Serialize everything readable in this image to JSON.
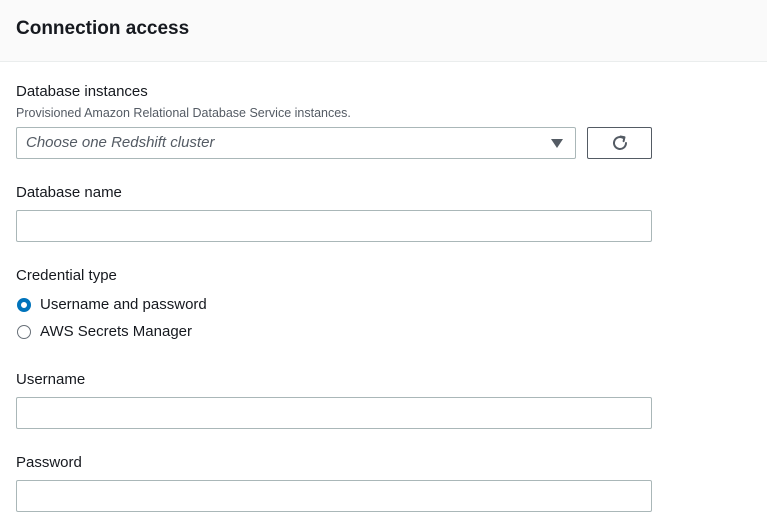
{
  "header": {
    "title": "Connection access"
  },
  "database_instances": {
    "label": "Database instances",
    "description": "Provisioned Amazon Relational Database Service instances.",
    "select_placeholder": "Choose one Redshift cluster",
    "caret_icon": "caret-down-icon",
    "refresh_icon": "refresh-icon"
  },
  "database_name": {
    "label": "Database name",
    "value": ""
  },
  "credential_type": {
    "label": "Credential type",
    "options": [
      {
        "label": "Username and password",
        "checked": true
      },
      {
        "label": "AWS Secrets Manager",
        "checked": false
      }
    ],
    "accent_color": "#0073bb"
  },
  "username": {
    "label": "Username",
    "value": ""
  },
  "password": {
    "label": "Password",
    "value": ""
  }
}
